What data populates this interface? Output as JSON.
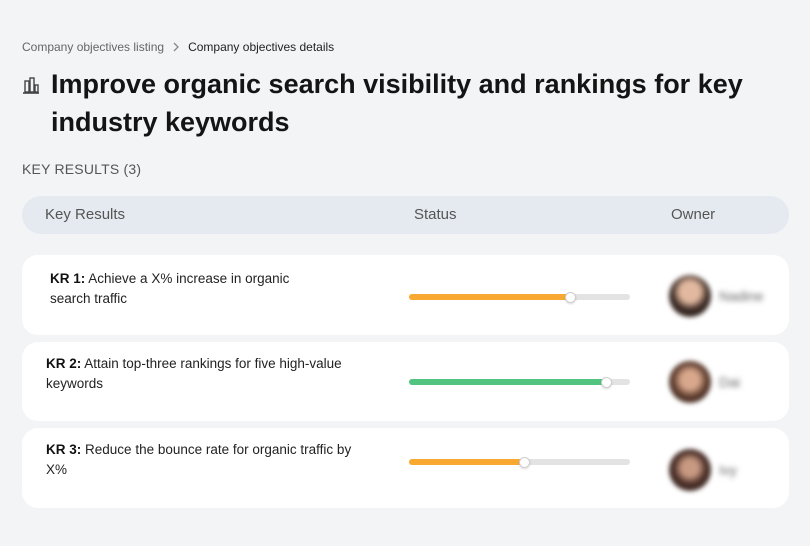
{
  "breadcrumb": {
    "parent": "Company objectives listing",
    "current": "Company objectives details"
  },
  "objective": {
    "title": "Improve organic search visibility and rankings for key industry keywords",
    "icon": "building-chart-icon"
  },
  "key_results_label": "KEY RESULTS (3)",
  "table": {
    "columns": [
      "Key Results",
      "Status",
      "Owner"
    ]
  },
  "key_results": [
    {
      "prefix": "KR 1:",
      "text": "Achieve a X% increase in organic search traffic",
      "progress": 0.73,
      "progress_color": "#f9a931",
      "owner": "Nadine"
    },
    {
      "prefix": "KR 2:",
      "text": "Attain top-three rankings for five high-value keywords",
      "progress": 0.89,
      "progress_color": "#52c47f",
      "owner": "Dai"
    },
    {
      "prefix": "KR 3:",
      "text": "Reduce the bounce rate for organic traffic by X%",
      "progress": 0.52,
      "progress_color": "#f9a931",
      "owner": "Ivy"
    }
  ]
}
